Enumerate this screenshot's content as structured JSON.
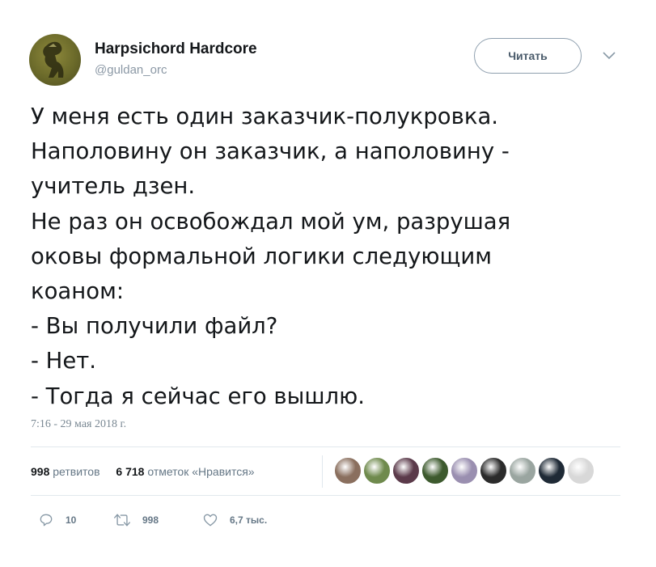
{
  "author": {
    "display_name": "Harpsichord Hardcore",
    "handle": "@guldan_orc",
    "avatar_icon": "orc-avatar"
  },
  "follow_button": {
    "label": "Читать"
  },
  "menu_icon": "chevron-down-icon",
  "tweet": {
    "text": "У меня есть один заказчик-полукровка.\nНаполовину он заказчик, а наполовину -\nучитель дзен.\nНе раз он освобождал мой ум, разрушая\nоковы формальной логики следующим\nкоаном:\n- Вы получили файл?\n- Нет.\n- Тогда я сейчас его вышлю.",
    "timestamp": "7:16 - 29 мая 2018 г."
  },
  "stats": {
    "retweets_count": "998",
    "retweets_label": "ретвитов",
    "likes_count": "6 718",
    "likes_label": "отметок «Нравится»"
  },
  "likers": [
    {
      "name": "liker-1",
      "color": "#8a6f5e"
    },
    {
      "name": "liker-2",
      "color": "#6f8a4d"
    },
    {
      "name": "liker-3",
      "color": "#5b3a4a"
    },
    {
      "name": "liker-4",
      "color": "#3d5a2e"
    },
    {
      "name": "liker-5",
      "color": "#9a8fb0"
    },
    {
      "name": "liker-6",
      "color": "#2b2b2b"
    },
    {
      "name": "liker-7",
      "color": "#9aa5a0"
    },
    {
      "name": "liker-8",
      "color": "#1f2a36"
    },
    {
      "name": "liker-9",
      "color": "#d8d8d8"
    }
  ],
  "actions": {
    "reply": {
      "icon": "reply-icon",
      "count": "10"
    },
    "retweet": {
      "icon": "retweet-icon",
      "count": "998"
    },
    "like": {
      "icon": "heart-icon",
      "count": "6,7 тыс."
    }
  },
  "colors": {
    "text": "#14171a",
    "secondary": "#657786",
    "divider": "#e1e8ed",
    "button_border": "#8e9fae"
  }
}
